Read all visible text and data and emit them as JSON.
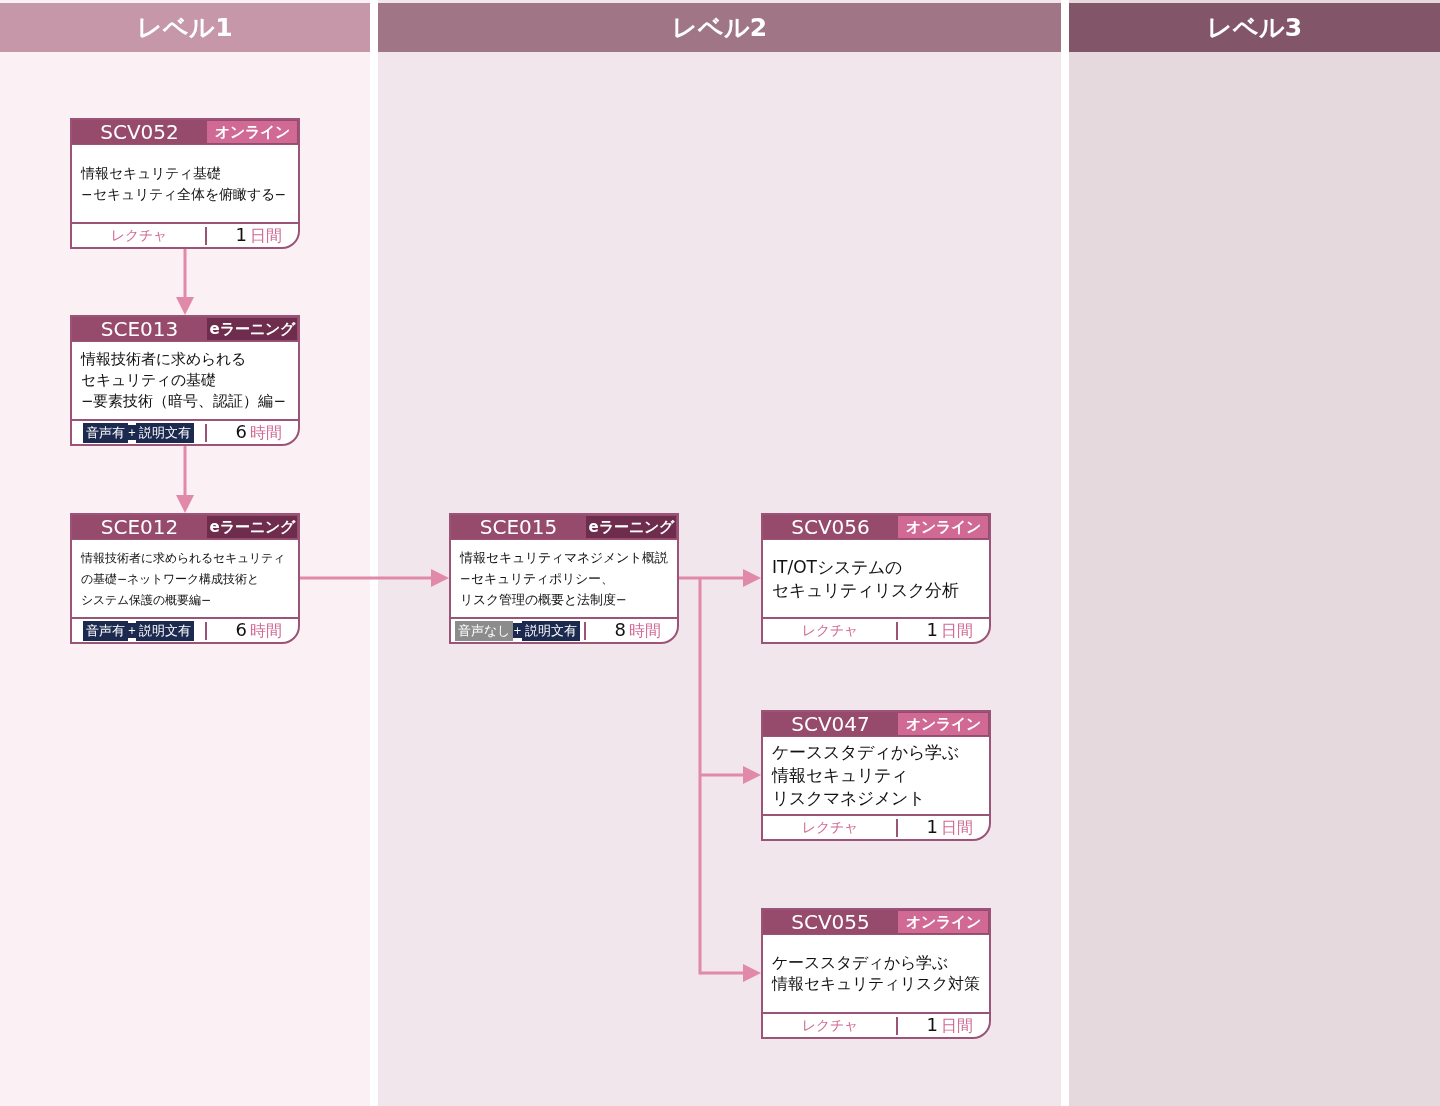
{
  "columns": [
    {
      "title": "レベル1",
      "cards": [
        {
          "code": "SCV052",
          "delivery": {
            "kind": "online",
            "label": "オンライン"
          },
          "title_lines": [
            "情報セキュリティ基礎",
            "−セキュリティ全体を俯瞰する−"
          ],
          "format": "レクチャ",
          "duration": "1",
          "unit": "日間"
        },
        {
          "code": "SCE013",
          "delivery": {
            "kind": "elearning",
            "label": "eラーニング"
          },
          "title_lines": [
            "情報技術者に求められる",
            "セキュリティの基礎",
            "−要素技術（暗号、認証）編−"
          ],
          "tags": [
            {
              "kind": "audio",
              "label": "音声有"
            },
            {
              "kind": "caption",
              "label": "説明文有"
            }
          ],
          "tag_separator": "+",
          "duration": "6",
          "unit": "時間"
        },
        {
          "code": "SCE012",
          "delivery": {
            "kind": "elearning",
            "label": "eラーニング"
          },
          "title_lines": [
            "情報技術者に求められるセキュリティ",
            "の基礎−ネットワーク構成技術と",
            "システム保護の概要編−"
          ],
          "tags": [
            {
              "kind": "audio",
              "label": "音声有"
            },
            {
              "kind": "caption",
              "label": "説明文有"
            }
          ],
          "tag_separator": "+",
          "duration": "6",
          "unit": "時間"
        }
      ]
    },
    {
      "title": "レベル2",
      "cards": [
        {
          "code": "SCE015",
          "delivery": {
            "kind": "elearning",
            "label": "eラーニング"
          },
          "title_lines": [
            "情報セキュリティマネジメント概説",
            "−セキュリティポリシー、",
            "リスク管理の概要と法制度−"
          ],
          "tags": [
            {
              "kind": "no-audio",
              "label": "音声なし"
            },
            {
              "kind": "caption",
              "label": "説明文有"
            }
          ],
          "tag_separator": "+",
          "duration": "8",
          "unit": "時間"
        },
        {
          "code": "SCV056",
          "delivery": {
            "kind": "online",
            "label": "オンライン"
          },
          "title_lines": [
            "IT/OTシステムの",
            "セキュリティリスク分析"
          ],
          "format": "レクチャ",
          "duration": "1",
          "unit": "日間"
        },
        {
          "code": "SCV047",
          "delivery": {
            "kind": "online",
            "label": "オンライン"
          },
          "title_lines": [
            "ケーススタディから学ぶ",
            "情報セキュリティ",
            "リスクマネジメント"
          ],
          "format": "レクチャ",
          "duration": "1",
          "unit": "日間"
        },
        {
          "code": "SCV055",
          "delivery": {
            "kind": "online",
            "label": "オンライン"
          },
          "title_lines": [
            "ケーススタディから学ぶ",
            "情報セキュリティリスク対策"
          ],
          "format": "レクチャ",
          "duration": "1",
          "unit": "日間"
        }
      ]
    },
    {
      "title": "レベル3"
    }
  ]
}
